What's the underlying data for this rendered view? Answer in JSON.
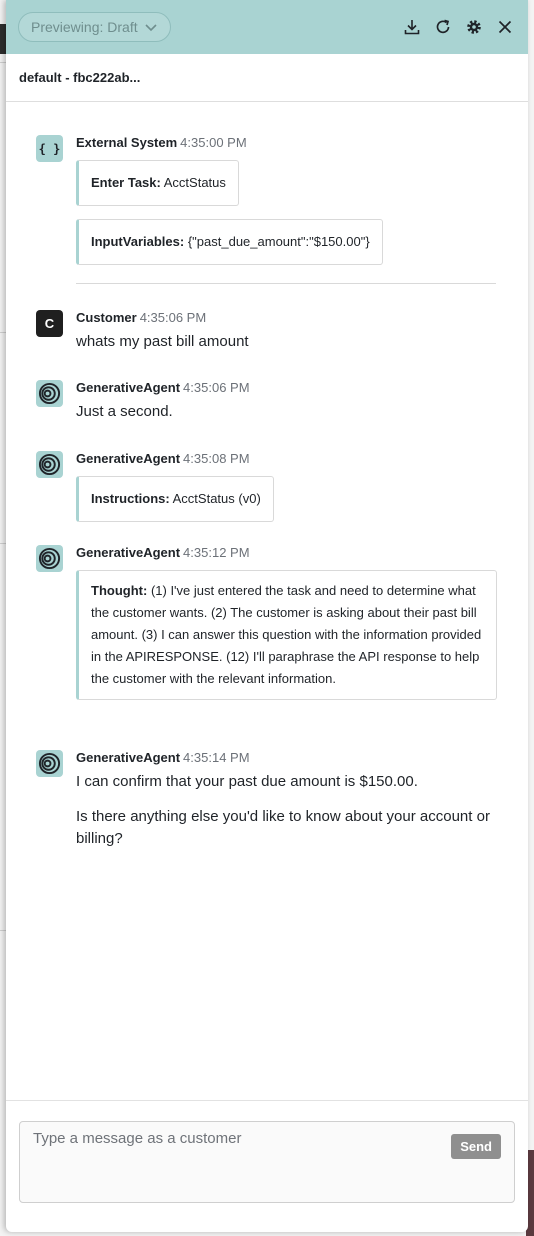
{
  "topbar": {
    "preview_label": "Previewing: Draft",
    "icons": [
      "download-icon",
      "refresh-icon",
      "gear-icon",
      "close-icon"
    ],
    "accent_color": "#a9d3d2"
  },
  "session": {
    "title": "default - fbc222ab..."
  },
  "messages": [
    {
      "sender": "External System",
      "time": "4:35:00 PM",
      "avatar": "{ }",
      "cards": [
        {
          "label": "Enter Task:",
          "value": "AcctStatus"
        },
        {
          "label": "InputVariables:",
          "value": "{\"past_due_amount\":\"$150.00\"}"
        }
      ]
    },
    {
      "sender": "Customer",
      "time": "4:35:06 PM",
      "avatar": "C",
      "text": "whats my past bill amount"
    },
    {
      "sender": "GenerativeAgent",
      "time": "4:35:06 PM",
      "text": "Just a second."
    },
    {
      "sender": "GenerativeAgent",
      "time": "4:35:08 PM",
      "card": {
        "label": "Instructions:",
        "value": "AcctStatus (v0)"
      }
    },
    {
      "sender": "GenerativeAgent",
      "time": "4:35:12 PM",
      "card": {
        "label": "Thought:",
        "value": "(1) I've just entered the task and need to determine what the customer wants. (2) The customer is asking about their past bill amount. (3) I can answer this question with the information provided in the APIRESPONSE. (12) I'll paraphrase the API response to help the customer with the relevant information."
      }
    },
    {
      "sender": "GenerativeAgent",
      "time": "4:35:14 PM",
      "paragraphs": [
        "I can confirm that your past due amount is $150.00.",
        "Is there anything else you'd like to know about your account or billing?"
      ]
    }
  ],
  "composer": {
    "placeholder": "Type a message as a customer",
    "send_label": "Send"
  }
}
